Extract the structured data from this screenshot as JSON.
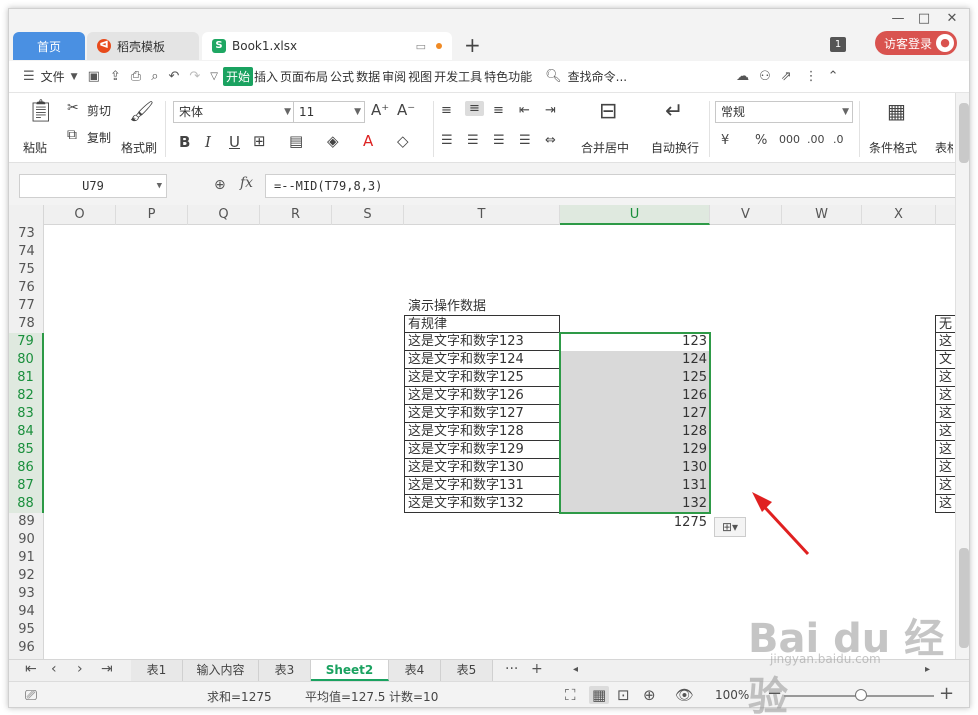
{
  "window": {
    "controls": [
      "—",
      "□",
      "✕"
    ]
  },
  "tabs": {
    "home": "首页",
    "docer": "稻壳模板",
    "book": "Book1.xlsx",
    "new_tab": "+"
  },
  "account": {
    "badge": "1",
    "guest_login": "访客登录"
  },
  "menu": {
    "file": "文件",
    "items": [
      "开始",
      "插入",
      "页面布局",
      "公式",
      "数据",
      "审阅",
      "视图",
      "开发工具",
      "特色功能"
    ],
    "active": "开始",
    "search": "查找命令..."
  },
  "ribbon": {
    "paste": "粘贴",
    "cut": "剪切",
    "copy": "复制",
    "format_painter": "格式刷",
    "font_name": "宋体",
    "font_size": "11",
    "merge_center": "合并居中",
    "wrap_text": "自动换行",
    "number_format": "常规",
    "conditional_format": "条件格式",
    "table_style": "表格"
  },
  "formula_bar": {
    "name_box": "U79",
    "fx": "fx",
    "formula": "=--MID(T79,8,3)"
  },
  "columns": [
    "O",
    "P",
    "Q",
    "R",
    "S",
    "T",
    "U",
    "V",
    "W",
    "X"
  ],
  "selected_column": "U",
  "rows": [
    "73",
    "74",
    "75",
    "76",
    "77",
    "78",
    "79",
    "80",
    "81",
    "82",
    "83",
    "84",
    "85",
    "86",
    "87",
    "88",
    "89",
    "90",
    "91",
    "92",
    "93",
    "94",
    "95",
    "96"
  ],
  "selected_rows": [
    "79",
    "80",
    "81",
    "82",
    "83",
    "84",
    "85",
    "86",
    "87",
    "88"
  ],
  "cells": {
    "title": "演示操作数据",
    "header": "有规律",
    "texts": [
      "这是文字和数字123",
      "这是文字和数字124",
      "这是文字和数字125",
      "这是文字和数字126",
      "这是文字和数字127",
      "这是文字和数字128",
      "这是文字和数字129",
      "这是文字和数字130",
      "这是文字和数字131",
      "这是文字和数字132"
    ],
    "values": [
      "123",
      "124",
      "125",
      "126",
      "127",
      "128",
      "129",
      "130",
      "131",
      "132"
    ],
    "total": "1275",
    "right_header": "无",
    "right_texts": [
      "这",
      "文",
      "这",
      "这",
      "这",
      "这",
      "这",
      "这",
      "这",
      "这"
    ]
  },
  "sheets": {
    "tabs": [
      "表1",
      "输入内容",
      "表3",
      "Sheet2",
      "表4",
      "表5"
    ],
    "active": "Sheet2",
    "more": "···",
    "add": "+"
  },
  "status": {
    "sum": "求和=1275",
    "average": "平均值=127.5",
    "count": "计数=10",
    "zoom": "100%"
  },
  "colors": {
    "accent_green": "#1aa260",
    "selection_border": "#2e9a47",
    "tab_blue": "#4a90e2",
    "guest_red": "#d9534f",
    "arrow_red": "#e02020"
  },
  "watermark": {
    "main": "Bai du 经验",
    "sub": "jingyan.baidu.com"
  }
}
